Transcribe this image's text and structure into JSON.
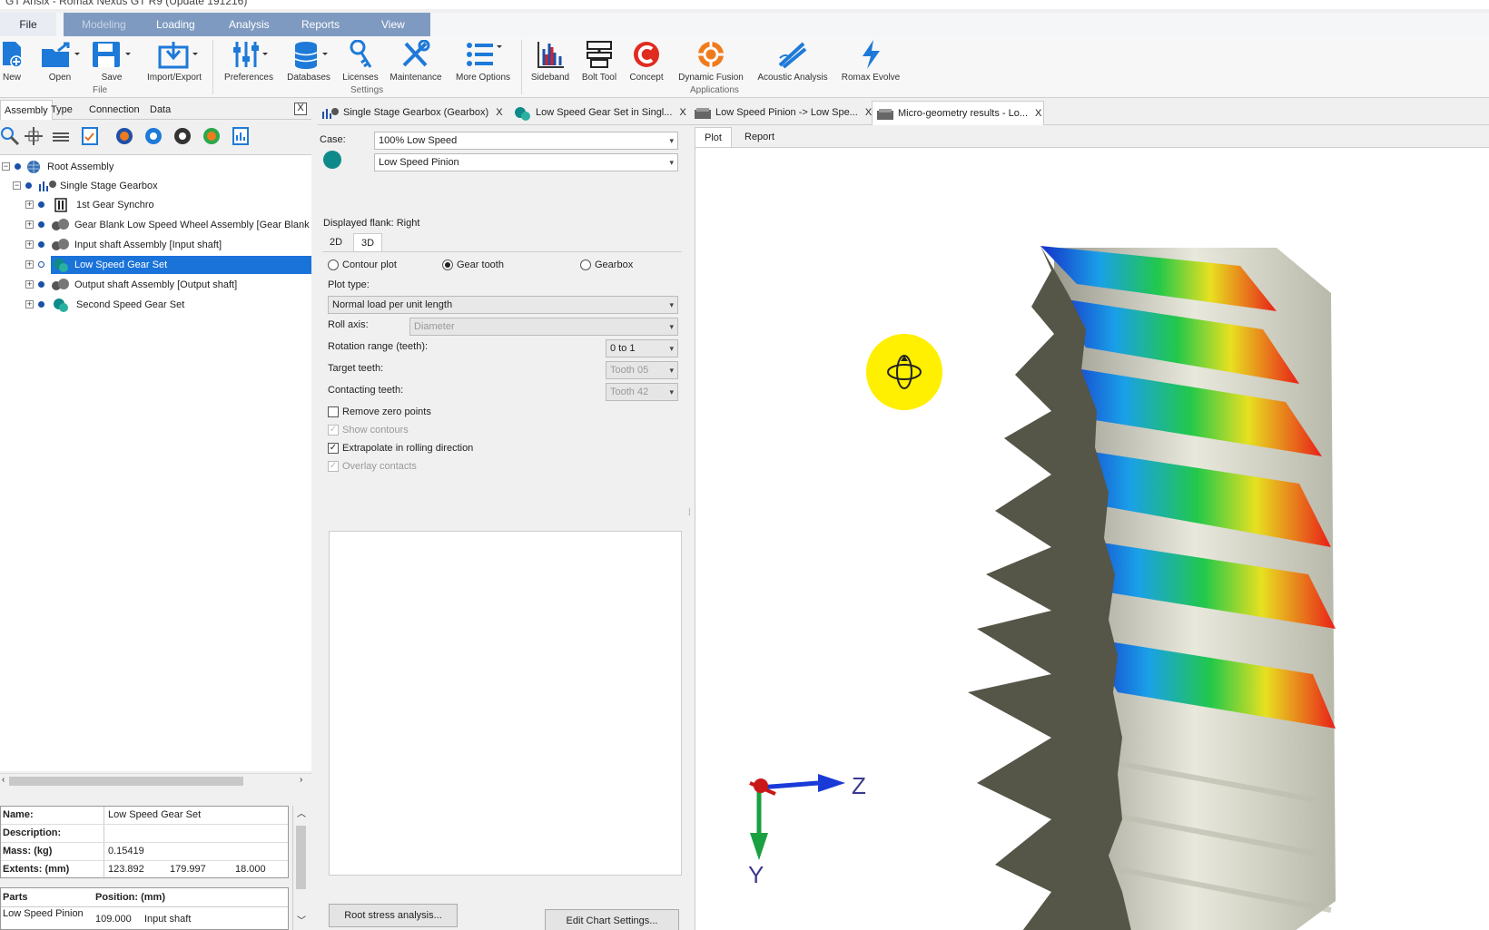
{
  "app": {
    "title": "GT Ansix - Romax Nexus GT R9 (Update 191216)"
  },
  "ribbon_tabs": [
    "File",
    "Modeling",
    "Loading",
    "Analysis",
    "Reports",
    "View"
  ],
  "ribbon": {
    "buttons": [
      {
        "label": "New",
        "icon": "new-icon"
      },
      {
        "label": "Open",
        "icon": "open-icon"
      },
      {
        "label": "Save",
        "icon": "save-icon"
      },
      {
        "label": "Import/Export",
        "icon": "import-export-icon"
      },
      {
        "label": "Preferences",
        "icon": "preferences-icon"
      },
      {
        "label": "Databases",
        "icon": "databases-icon"
      },
      {
        "label": "Licenses",
        "icon": "licenses-icon"
      },
      {
        "label": "Maintenance",
        "icon": "maintenance-icon"
      },
      {
        "label": "More Options",
        "icon": "more-options-icon"
      },
      {
        "label": "Sideband",
        "icon": "sideband-icon"
      },
      {
        "label": "Bolt Tool",
        "icon": "bolt-tool-icon"
      },
      {
        "label": "Concept",
        "icon": "concept-icon"
      },
      {
        "label": "Dynamic Fusion",
        "icon": "dynamic-fusion-icon"
      },
      {
        "label": "Acoustic Analysis",
        "icon": "acoustic-analysis-icon"
      },
      {
        "label": "Romax Evolve",
        "icon": "romax-evolve-icon"
      }
    ],
    "groups": [
      "File",
      "Settings",
      "Applications"
    ]
  },
  "left_panel": {
    "tabs": [
      "Assembly",
      "Type",
      "Connection",
      "Data"
    ],
    "close": "X",
    "tree": [
      {
        "label": "Root Assembly"
      },
      {
        "label": "Single Stage Gearbox"
      },
      {
        "label": "1st Gear Synchro"
      },
      {
        "label": "Gear Blank Low Speed Wheel Assembly [Gear Blank Lo"
      },
      {
        "label": "Input shaft Assembly [Input shaft]"
      },
      {
        "label": "Low Speed Gear Set"
      },
      {
        "label": "Output shaft Assembly [Output shaft]"
      },
      {
        "label": "Second Speed Gear Set"
      }
    ],
    "properties": {
      "name_label": "Name:",
      "name_value": "Low Speed Gear Set",
      "desc_label": "Description:",
      "desc_value": "",
      "mass_label": "Mass: (kg)",
      "mass_value": "0.15419",
      "ext_label": "Extents: (mm)",
      "ext_values": [
        "123.892",
        "179.997",
        "18.000"
      ]
    },
    "parts": {
      "col1": "Parts",
      "col2": "Position: (mm)",
      "row_name": "Low Speed Pinion",
      "row_pos": "109.000",
      "row_shaft": "Input shaft"
    }
  },
  "doc_tabs": [
    {
      "label": "Single Stage Gearbox (Gearbox)",
      "x": "X"
    },
    {
      "label": "Low Speed Gear Set in Singl...",
      "x": "X"
    },
    {
      "label": "Low Speed Pinion -> Low Spe...",
      "x": "X"
    },
    {
      "label": "Micro-geometry results - Lo...",
      "x": "X"
    }
  ],
  "settings": {
    "case_label": "Case:",
    "case_value": "100% Low Speed",
    "part_value": "Low Speed Pinion",
    "displayed_flank": "Displayed flank: Right",
    "sub_tabs": [
      "2D",
      "3D"
    ],
    "radio_contour": "Contour plot",
    "radio_gear_tooth": "Gear tooth",
    "radio_gearbox": "Gearbox",
    "plot_type_label": "Plot type:",
    "plot_type_value": "Normal load per unit length",
    "roll_axis_label": "Roll axis:",
    "roll_axis_value": "Diameter",
    "rotation_label": "Rotation range (teeth):",
    "rotation_value": "0 to  1",
    "target_label": "Target teeth:",
    "target_value": "Tooth 05",
    "contacting_label": "Contacting teeth:",
    "contacting_value": "Tooth 42",
    "chk_remove_zero": "Remove zero points",
    "chk_show_contours": "Show contours",
    "chk_extrapolate": "Extrapolate in rolling direction",
    "chk_overlay": "Overlay contacts",
    "root_stress_btn": "Root stress analysis...",
    "edit_chart_btn": "Edit Chart Settings..."
  },
  "view": {
    "tabs": [
      "Plot",
      "Report"
    ],
    "axis_z": "Z",
    "axis_y": "Y"
  },
  "colors": {
    "selection": "#1a73d9",
    "ribbon_tab_bg": "#7f9ac0",
    "cursor_highlight": "#ffef00"
  }
}
